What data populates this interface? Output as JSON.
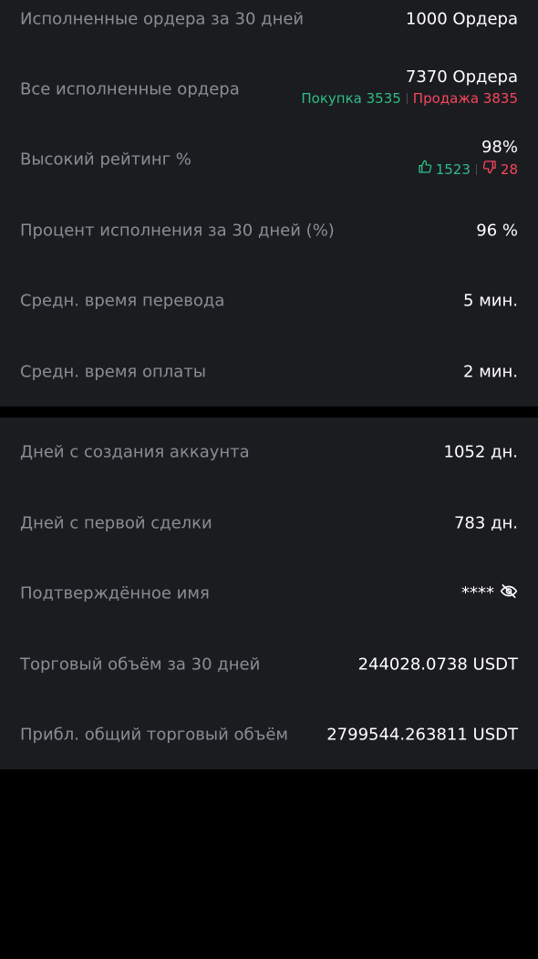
{
  "stats": {
    "completed_30d": {
      "label": "Исполненные ордера за 30 дней",
      "value": "1000 Ордера"
    },
    "completed_all": {
      "label": "Все исполненные ордера",
      "value": "7370 Ордера",
      "buy": "Покупка 3535",
      "sell": "Продажа 3835"
    },
    "rating": {
      "label": "Высокий рейтинг %",
      "value": "98%",
      "likes": "1523",
      "dislikes": "28"
    },
    "completion_rate": {
      "label": "Процент исполнения за 30 дней (%)",
      "value": "96 %"
    },
    "avg_transfer": {
      "label": "Средн. время перевода",
      "value": "5 мин."
    },
    "avg_payment": {
      "label": "Средн. время оплаты",
      "value": "2 мин."
    }
  },
  "account": {
    "days_since_creation": {
      "label": "Дней с создания аккаунта",
      "value": "1052 дн."
    },
    "days_since_first_trade": {
      "label": "Дней с первой сделки",
      "value": "783 дн."
    },
    "verified_name": {
      "label": "Подтверждённое имя",
      "value": "****",
      "icon": "eye-off-icon"
    },
    "volume_30d": {
      "label": "Торговый объём за 30 дней",
      "value": "244028.0738 USDT"
    },
    "volume_total": {
      "label": "Прибл. общий торговый объём",
      "value": "2799544.263811 USDT"
    }
  },
  "colors": {
    "positive": "#2ebd85",
    "negative": "#f6465d",
    "card": "#1b1c20",
    "label": "#8b8d93"
  }
}
